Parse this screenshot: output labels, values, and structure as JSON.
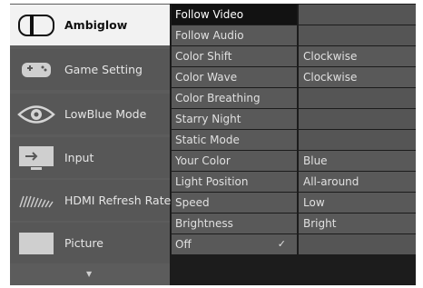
{
  "menu": {
    "items": [
      {
        "label": "Ambiglow",
        "icon": "ambiglow-icon",
        "selected": true
      },
      {
        "label": "Game Setting",
        "icon": "gamepad-icon",
        "selected": false
      },
      {
        "label": "LowBlue Mode",
        "icon": "eye-icon",
        "selected": false
      },
      {
        "label": "Input",
        "icon": "input-icon",
        "selected": false
      },
      {
        "label": "HDMI Refresh Rate",
        "icon": "refresh-rate-icon",
        "selected": false
      },
      {
        "label": "Picture",
        "icon": "picture-icon",
        "selected": false
      }
    ],
    "scroll_indicator": "▼"
  },
  "submenu": {
    "items": [
      {
        "label": "Follow Video",
        "selected": true
      },
      {
        "label": "Follow Audio"
      },
      {
        "label": "Color Shift"
      },
      {
        "label": "Color Wave"
      },
      {
        "label": "Color Breathing"
      },
      {
        "label": "Starry Night"
      },
      {
        "label": "Static Mode"
      },
      {
        "label": "Your Color"
      },
      {
        "label": "Light Position"
      },
      {
        "label": "Speed"
      },
      {
        "label": "Brightness"
      },
      {
        "label": "Off",
        "check": "✓"
      }
    ]
  },
  "values": {
    "items": [
      "",
      "",
      "Clockwise",
      "Clockwise",
      "",
      "",
      "",
      "Blue",
      "All-around",
      "Low",
      "Bright",
      ""
    ]
  }
}
